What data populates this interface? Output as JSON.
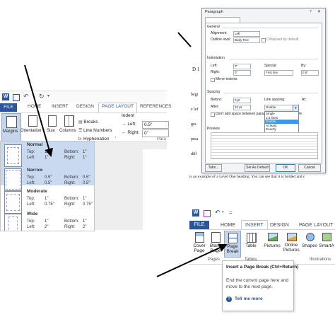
{
  "left_ribbon": {
    "tabs": [
      "FILE",
      "HOME",
      "INSERT",
      "DESIGN",
      "PAGE LAYOUT",
      "REFERENCES"
    ],
    "buttons": {
      "margins": "Margins",
      "orientation": "Orientation",
      "size": "Size",
      "columns": "Columns",
      "breaks": "Breaks",
      "line_numbers": "Line Numbers",
      "hyphenation": "Hyphenation"
    },
    "indent": {
      "header": "Indent",
      "left_label": "Left:",
      "left_value": "0.5\"",
      "right_label": "Right:",
      "right_value": "0\""
    },
    "para_label": "Para"
  },
  "margins_menu": [
    {
      "name": "Normal",
      "top": "1\"",
      "bottom": "1\"",
      "left": "1\"",
      "right": "1\""
    },
    {
      "name": "Narrow",
      "top": "0.5\"",
      "bottom": "0.5\"",
      "left": "0.5\"",
      "right": "0.5\""
    },
    {
      "name": "Moderate",
      "top": "1\"",
      "bottom": "1\"",
      "left": "0.75\"",
      "right": "0.75\""
    },
    {
      "name": "Wide",
      "top": "1\"",
      "bottom": "1\"",
      "left": "2\"",
      "right": "2\""
    }
  ],
  "margin_labels": {
    "top": "Top:",
    "bottom": "Bottom:",
    "left": "Left:",
    "right": "Right:"
  },
  "paragraph_dialog": {
    "title": "Paragraph",
    "tabs": [
      "Indents and Spacing",
      "Line and Page Breaks"
    ],
    "general": {
      "header": "General",
      "alignment_label": "Alignment:",
      "alignment_value": "Left",
      "outline_label": "Outline level:",
      "outline_value": "Body Text",
      "collapsed_label": "Collapsed by default"
    },
    "indentation": {
      "header": "Indentation",
      "left_label": "Left:",
      "left_value": "0\"",
      "right_label": "Right:",
      "right_value": "0\"",
      "special_label": "Special:",
      "special_value": "First line",
      "by_label": "By:",
      "by_value": "0.5\"",
      "mirror_label": "Mirror indents"
    },
    "spacing": {
      "header": "Spacing",
      "before_label": "Before:",
      "before_value": "0 pt",
      "after_label": "After:",
      "after_value": "10 pt",
      "line_spacing_label": "Line spacing:",
      "line_spacing_value": "Double",
      "at_label": "At:",
      "dont_add_label": "Don't add space between paragraphs of the same style",
      "options": [
        "Single",
        "1.5 lines",
        "Double",
        "At least",
        "Exactly",
        "Multiple"
      ],
      "selected_index": 2
    },
    "preview_label": "Preview",
    "buttons": {
      "tabs": "Tabs...",
      "set_default": "Set As Default",
      "ok": "OK",
      "cancel": "Cancel"
    }
  },
  "document_text": {
    "line_d": "D 1",
    "fragments": [
      "begi",
      "e lef",
      "gra",
      "prea",
      "diff"
    ],
    "sentence": "is an example of a Level One heading.  You can see that it is bolded and c"
  },
  "insert_ribbon": {
    "qat": "=",
    "tabs": [
      "FILE",
      "HOME",
      "INSERT",
      "DESIGN",
      "PAGE LAYOUT"
    ],
    "buttons": {
      "cover_page": "Cover Page",
      "blank_page": "Blank Page",
      "page_break": "Page Break",
      "table": "Table",
      "pictures": "Pictures",
      "online_pictures": "Online Pictures",
      "shapes": "Shapes",
      "smartart": "SmartA"
    },
    "groups": {
      "pages": "Pages",
      "tables": "Tables",
      "illustrations": "Illustrations"
    },
    "tooltip": {
      "title": "Insert a Page Break (Ctrl+Return)",
      "body": "End the current page here and move to the next page.",
      "link": "Tell me more"
    }
  }
}
